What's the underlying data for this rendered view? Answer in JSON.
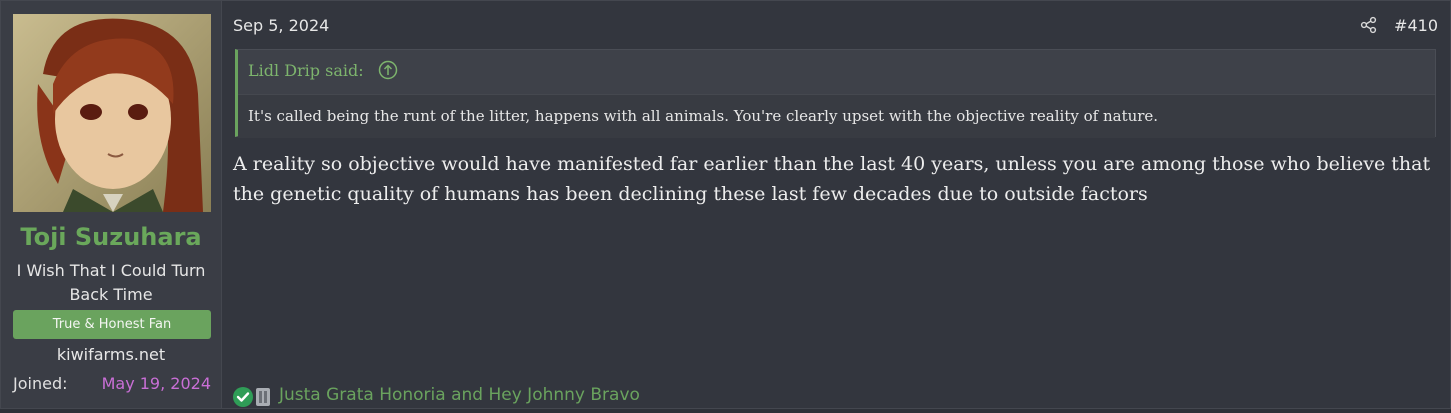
{
  "user": {
    "username": "Toji Suzuhara",
    "title": "I Wish That I Could Turn Back Time",
    "banner": "True & Honest Fan",
    "site": "kiwifarms.net",
    "joined_label": "Joined:",
    "joined_date": "May 19, 2024",
    "avatar": "avatar-image"
  },
  "post": {
    "date": "Sep 5, 2024",
    "number": "#410",
    "share_icon": "share-icon",
    "quote": {
      "author_said": "Lidl Drip said:",
      "up_icon": "arrow-up-circle-icon",
      "text": "It's called being the runt of the litter, happens with all animals. You're clearly upset with the objective reality of nature."
    },
    "body": "A reality so objective would have manifested far earlier than the last 40 years, unless you are among those who believe that the genetic quality of humans has been declining these last few decades due to outside factors",
    "reactions": {
      "icons": [
        "check-reaction-icon",
        "grey-reaction-icon"
      ],
      "names": "Justa Grata Honoria and Hey Johnny Bravo"
    }
  },
  "colors": {
    "accent_green": "#6aa35e",
    "username_green": "#6aa85b",
    "join_date_purple": "#c96fd6",
    "background": "#33363e"
  }
}
